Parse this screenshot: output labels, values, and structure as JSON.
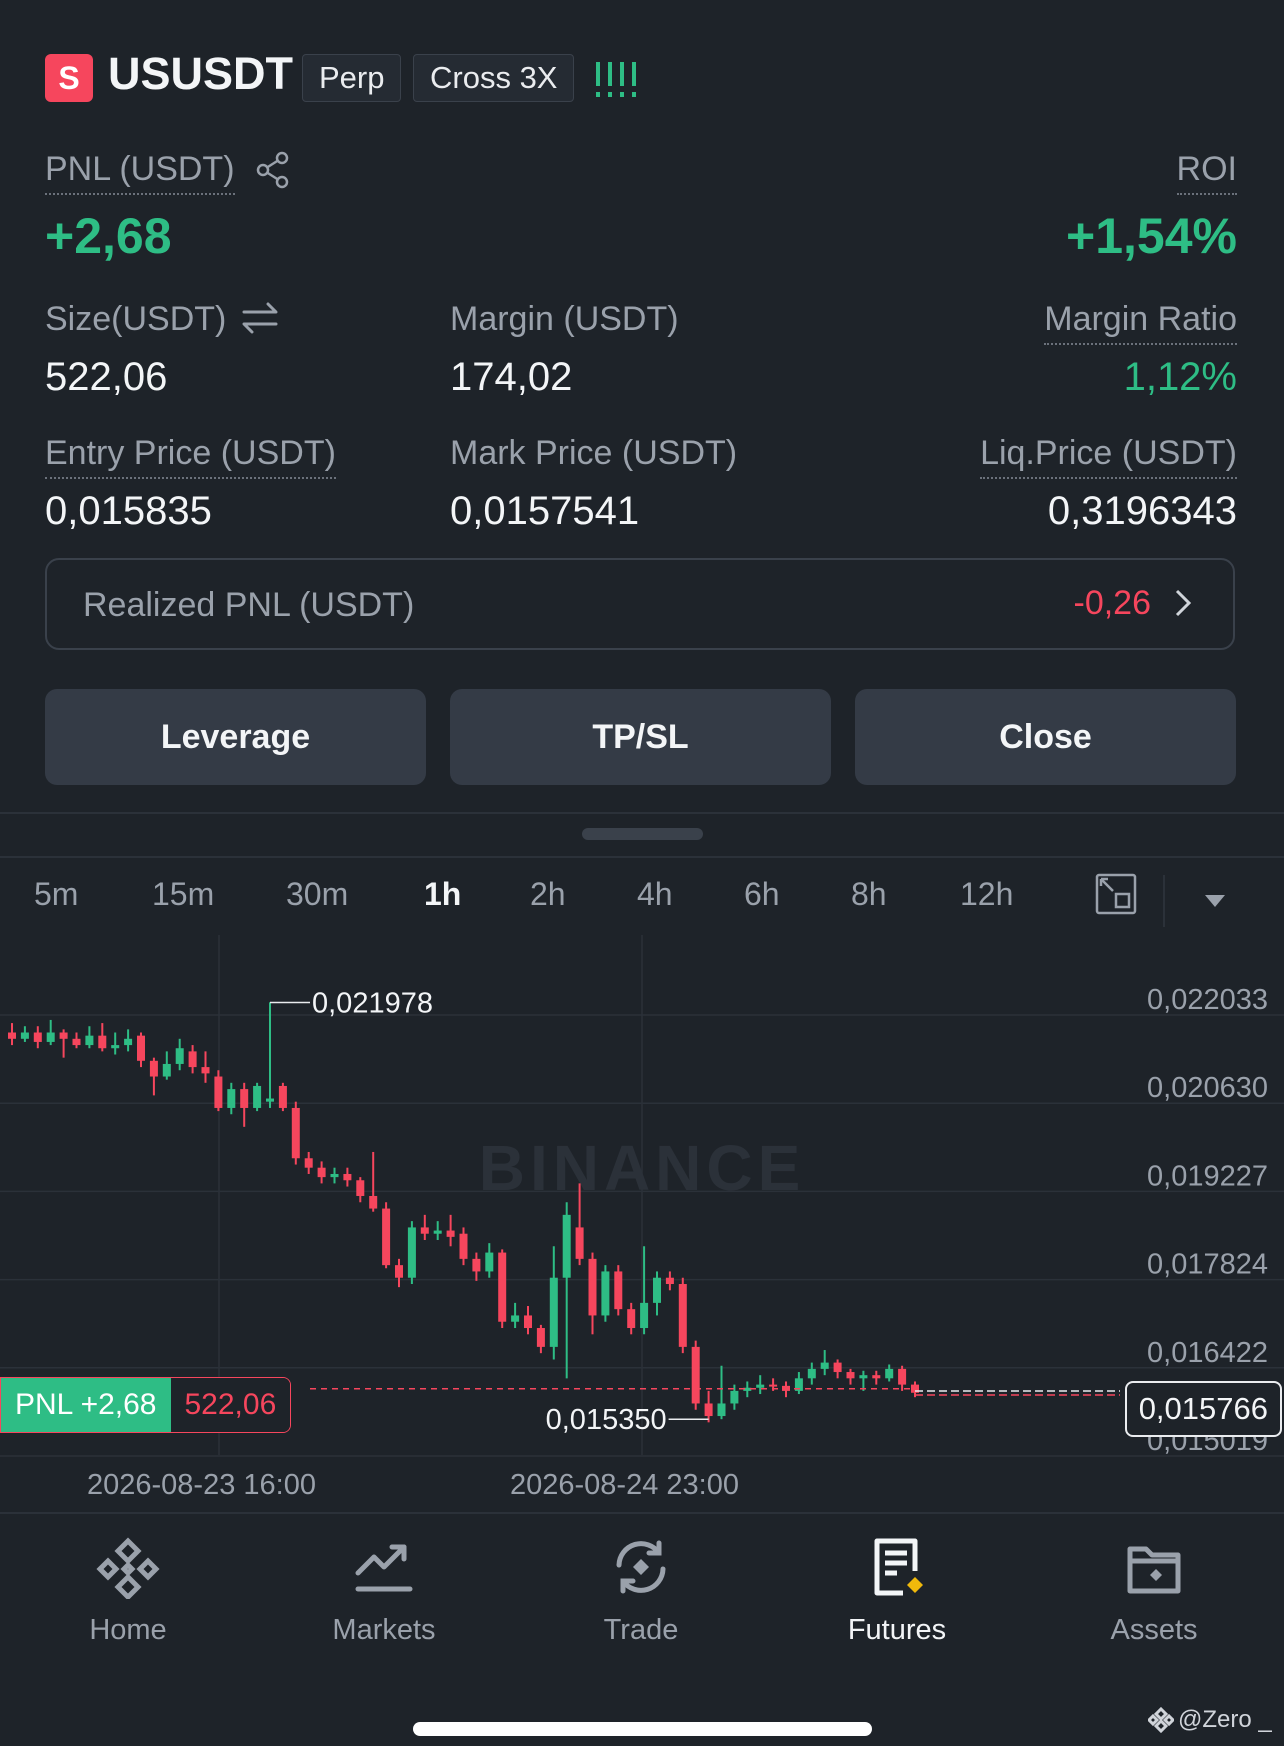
{
  "header": {
    "symbol_icon": "S",
    "symbol": "USUSDT",
    "type_tag": "Perp",
    "margin_tag": "Cross 3X",
    "signal_icon": "!!!!"
  },
  "position": {
    "pnl_label": "PNL (USDT)",
    "pnl_value": "+2,68",
    "roi_label": "ROI",
    "roi_value": "+1,54%",
    "size_label": "Size(USDT)",
    "size_value": "522,06",
    "margin_label": "Margin (USDT)",
    "margin_value": "174,02",
    "margin_ratio_label": "Margin Ratio",
    "margin_ratio_value": "1,12%",
    "entry_label": "Entry Price (USDT)",
    "entry_value": "0,015835",
    "mark_label": "Mark Price (USDT)",
    "mark_value": "0,0157541",
    "liq_label": "Liq.Price (USDT)",
    "liq_value": "0,3196343",
    "realized_label": "Realized PNL (USDT)",
    "realized_value": "-0,26"
  },
  "actions": {
    "leverage": "Leverage",
    "tpsl": "TP/SL",
    "close": "Close"
  },
  "timeframes": [
    "5m",
    "15m",
    "30m",
    "1h",
    "2h",
    "4h",
    "6h",
    "8h",
    "12h"
  ],
  "active_timeframe": "1h",
  "chart": {
    "watermark": "BINANCE",
    "y_ticks": [
      "0,022033",
      "0,020630",
      "0,019227",
      "0,017824",
      "0,016422",
      "0,015019"
    ],
    "x_ticks": [
      "2026-08-23 16:00",
      "2026-08-24 23:00"
    ],
    "high_label": "0,021978",
    "low_label": "0,015350",
    "current_price": "0,015766",
    "pnl_pill": "PNL +2,68",
    "size_pill": "522,06"
  },
  "chart_data": {
    "type": "candlestick",
    "y_range": [
      0.015019,
      0.022033
    ],
    "high": 0.021978,
    "low": 0.01535,
    "last": 0.015766,
    "entry": 0.015835,
    "up_color": "#2ebd85",
    "down_color": "#f6465d",
    "candles": [
      [
        0.0215,
        0.0214,
        0.02165,
        0.0213
      ],
      [
        0.0214,
        0.0215,
        0.0216,
        0.02135
      ],
      [
        0.0215,
        0.02135,
        0.0216,
        0.02125
      ],
      [
        0.02135,
        0.0215,
        0.0217,
        0.0213
      ],
      [
        0.0215,
        0.0214,
        0.02155,
        0.0211
      ],
      [
        0.0214,
        0.0213,
        0.0215,
        0.02125
      ],
      [
        0.0213,
        0.02145,
        0.0216,
        0.02125
      ],
      [
        0.02145,
        0.02125,
        0.02165,
        0.0212
      ],
      [
        0.02125,
        0.0213,
        0.0215,
        0.02115
      ],
      [
        0.0213,
        0.0214,
        0.02155,
        0.0212
      ],
      [
        0.02145,
        0.02105,
        0.0215,
        0.02095
      ],
      [
        0.02105,
        0.0208,
        0.0211,
        0.0205
      ],
      [
        0.0208,
        0.021,
        0.0212,
        0.02075
      ],
      [
        0.021,
        0.02125,
        0.0214,
        0.0209
      ],
      [
        0.0212,
        0.02095,
        0.0213,
        0.02085
      ],
      [
        0.02095,
        0.02085,
        0.0212,
        0.0207
      ],
      [
        0.0208,
        0.0203,
        0.0209,
        0.02025
      ],
      [
        0.0203,
        0.0206,
        0.0207,
        0.0202
      ],
      [
        0.0206,
        0.0203,
        0.0207,
        0.02
      ],
      [
        0.0203,
        0.02065,
        0.0207,
        0.02025
      ],
      [
        0.0204,
        0.02045,
        0.02198,
        0.0203
      ],
      [
        0.02065,
        0.0203,
        0.0207,
        0.02025
      ],
      [
        0.0203,
        0.0195,
        0.0204,
        0.0194
      ],
      [
        0.0195,
        0.01935,
        0.0196,
        0.01925
      ],
      [
        0.01935,
        0.0192,
        0.01945,
        0.0191
      ],
      [
        0.0192,
        0.01925,
        0.01935,
        0.0191
      ],
      [
        0.01925,
        0.01915,
        0.01935,
        0.01905
      ],
      [
        0.01915,
        0.0189,
        0.0192,
        0.0188
      ],
      [
        0.0189,
        0.0187,
        0.0196,
        0.01865
      ],
      [
        0.0187,
        0.0178,
        0.0188,
        0.01775
      ],
      [
        0.0178,
        0.0176,
        0.0179,
        0.01745
      ],
      [
        0.0176,
        0.0184,
        0.0185,
        0.0175
      ],
      [
        0.0184,
        0.0183,
        0.0186,
        0.0182
      ],
      [
        0.0183,
        0.01835,
        0.0185,
        0.0182
      ],
      [
        0.01835,
        0.01825,
        0.0186,
        0.0181
      ],
      [
        0.0183,
        0.0179,
        0.0184,
        0.0178
      ],
      [
        0.0179,
        0.0177,
        0.018,
        0.01755
      ],
      [
        0.0177,
        0.018,
        0.01815,
        0.0176
      ],
      [
        0.018,
        0.0169,
        0.01805,
        0.0168
      ],
      [
        0.0169,
        0.017,
        0.0172,
        0.0168
      ],
      [
        0.017,
        0.0168,
        0.01715,
        0.0167
      ],
      [
        0.0168,
        0.0165,
        0.01685,
        0.0164
      ],
      [
        0.0165,
        0.0176,
        0.0181,
        0.0163
      ],
      [
        0.0176,
        0.0186,
        0.0188,
        0.016
      ],
      [
        0.0184,
        0.0179,
        0.0191,
        0.0178
      ],
      [
        0.0179,
        0.017,
        0.018,
        0.0167
      ],
      [
        0.017,
        0.0177,
        0.0178,
        0.0169
      ],
      [
        0.0177,
        0.0171,
        0.0178,
        0.017
      ],
      [
        0.0171,
        0.0168,
        0.0172,
        0.0167
      ],
      [
        0.0168,
        0.0172,
        0.0181,
        0.0167
      ],
      [
        0.0172,
        0.0176,
        0.0177,
        0.017
      ],
      [
        0.0176,
        0.0175,
        0.0177,
        0.0174
      ],
      [
        0.0175,
        0.0165,
        0.0176,
        0.0164
      ],
      [
        0.0165,
        0.0156,
        0.0166,
        0.0155
      ],
      [
        0.0156,
        0.0154,
        0.0158,
        0.0153
      ],
      [
        0.0154,
        0.0156,
        0.0162,
        0.01535
      ],
      [
        0.0156,
        0.0158,
        0.0159,
        0.0155
      ],
      [
        0.0158,
        0.01585,
        0.01595,
        0.0157
      ],
      [
        0.01585,
        0.0159,
        0.01605,
        0.01575
      ],
      [
        0.0159,
        0.01588,
        0.016,
        0.0158
      ],
      [
        0.01588,
        0.0158,
        0.01595,
        0.0157
      ],
      [
        0.0158,
        0.016,
        0.0161,
        0.01575
      ],
      [
        0.016,
        0.01615,
        0.01625,
        0.0159
      ],
      [
        0.01615,
        0.01625,
        0.01645,
        0.01605
      ],
      [
        0.01625,
        0.0161,
        0.0163,
        0.016
      ],
      [
        0.0161,
        0.016,
        0.01615,
        0.0159
      ],
      [
        0.016,
        0.01605,
        0.01612,
        0.0158
      ],
      [
        0.01605,
        0.016,
        0.01612,
        0.0159
      ],
      [
        0.016,
        0.01615,
        0.01622,
        0.01595
      ],
      [
        0.01615,
        0.0159,
        0.0162,
        0.0158
      ],
      [
        0.0159,
        0.01577,
        0.01595,
        0.0157
      ]
    ]
  },
  "bottom_nav": {
    "items": [
      {
        "label": "Home",
        "icon": "home-diamond-icon"
      },
      {
        "label": "Markets",
        "icon": "trend-chart-icon"
      },
      {
        "label": "Trade",
        "icon": "trade-swap-icon"
      },
      {
        "label": "Futures",
        "icon": "futures-document-icon"
      },
      {
        "label": "Assets",
        "icon": "wallet-icon"
      }
    ],
    "active": "Futures"
  },
  "footer": {
    "credit": "@Zero _"
  },
  "colors": {
    "background": "#1e2329",
    "green": "#2ebd85",
    "red": "#f6465d",
    "brand": "#f0b90b"
  }
}
